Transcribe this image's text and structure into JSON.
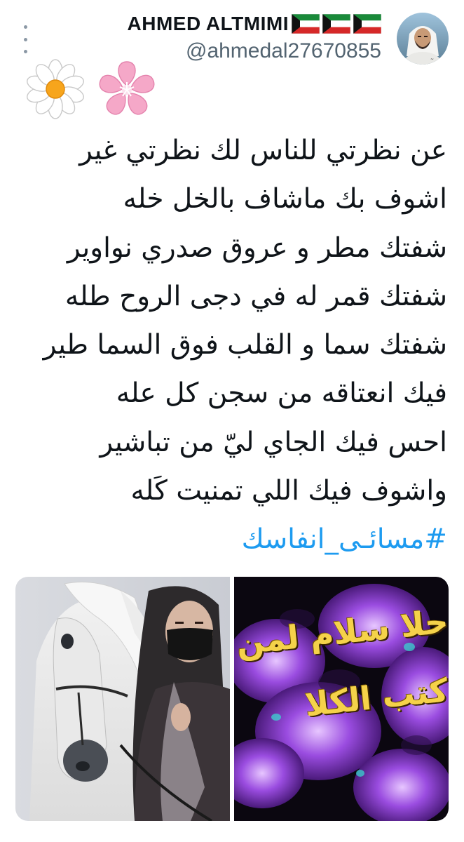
{
  "tweet": {
    "author": {
      "display_name": "AHMED ALTMIMI",
      "handle": "@ahmedal27670855",
      "avatar_icon": "profile-photo",
      "flag_icon": "kuwait-flag",
      "flag_count": 3
    },
    "decorations": [
      "white-daisy-icon",
      "pink-cherry-blossom-icon"
    ],
    "lines": [
      "عن نظرتي للناس لك نظرتي غير",
      "اشوف بك ماشاف بالخل خله",
      "شفتك مطر و عروق صدري نواوير",
      "شفتك قمر له في دجى الروح طله",
      "شفتك سما و القلب فوق السما طير",
      "فيك انعتاقه من سجن كل عله",
      "احس فيك الجاي ليّ من تباشير",
      "واشوف فيك اللي تمنيت كَله"
    ],
    "hashtag": "#مسائـى_انفاسك",
    "media": {
      "left_image": "woman-with-white-horse-photo",
      "right_image": {
        "description_icon": "purple-flowers-greeting-image",
        "line1": "حلا سلام لمن",
        "line2": "كتب الكلا"
      }
    }
  },
  "colors": {
    "text": "#0f1419",
    "secondary": "#536471",
    "link": "#1d9bf0"
  }
}
